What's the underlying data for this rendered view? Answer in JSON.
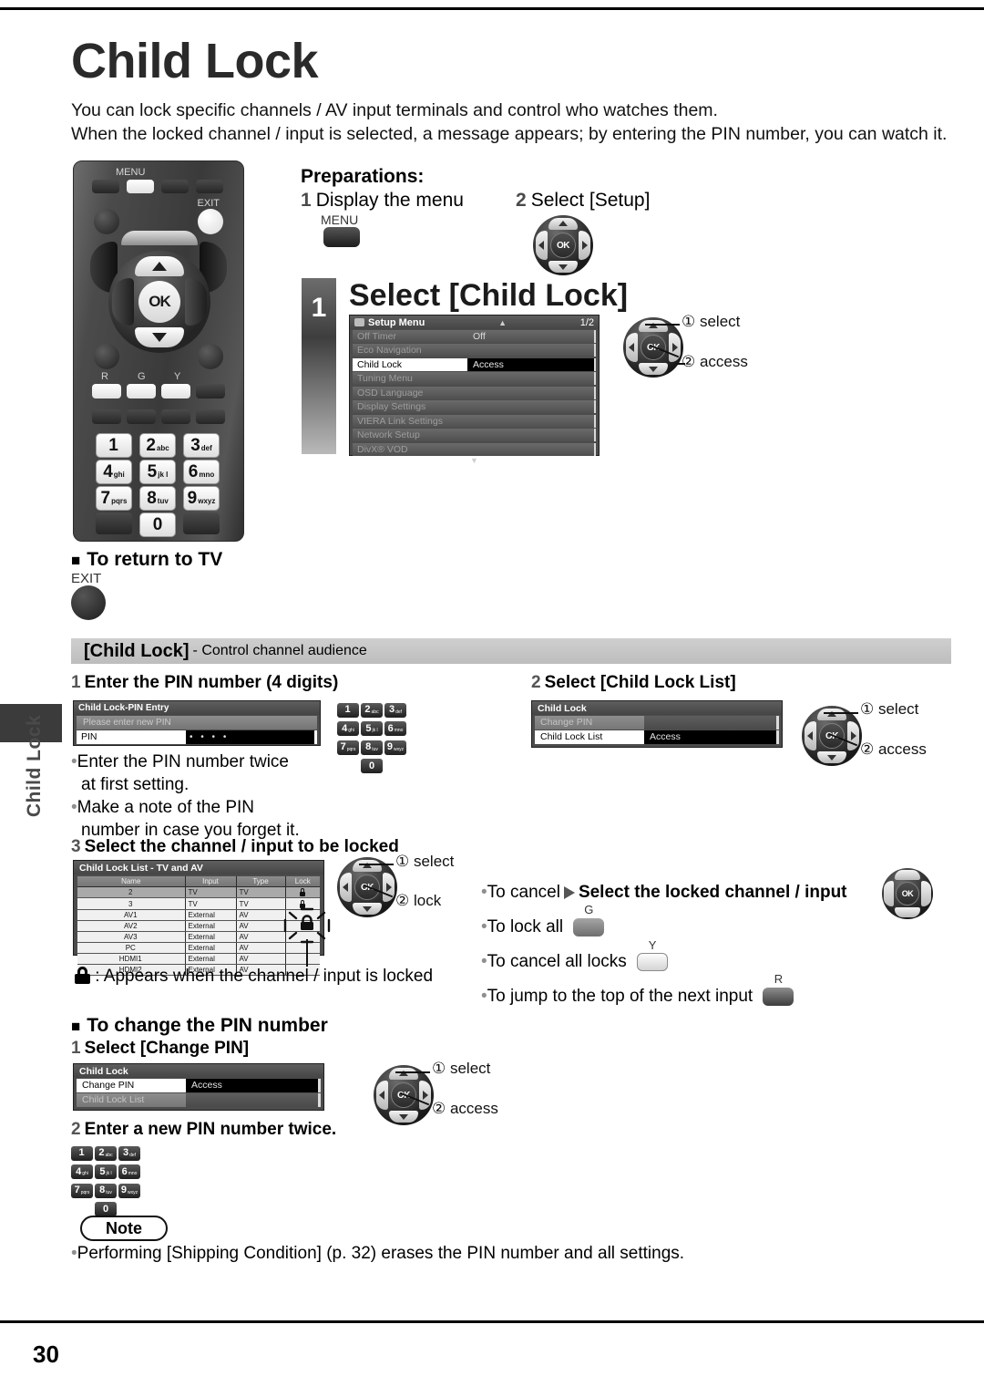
{
  "page": {
    "title": "Child Lock",
    "number": "30",
    "side_tab_label": "Child Lock",
    "intro_lines": [
      "You can lock specific channels / AV input terminals and control who watches them.",
      "When the locked channel / input is selected, a message appears; by entering the PIN number, you can watch it."
    ]
  },
  "remote": {
    "menu_label": "MENU",
    "exit_label": "EXIT",
    "ok_label": "OK",
    "color_labels": [
      "R",
      "G",
      "Y"
    ],
    "keys": [
      {
        "digit": "1",
        "letters": ""
      },
      {
        "digit": "2",
        "letters": "abc"
      },
      {
        "digit": "3",
        "letters": "def"
      },
      {
        "digit": "4",
        "letters": "ghi"
      },
      {
        "digit": "5",
        "letters": "jk l"
      },
      {
        "digit": "6",
        "letters": "mno"
      },
      {
        "digit": "7",
        "letters": "pqrs"
      },
      {
        "digit": "8",
        "letters": "tuv"
      },
      {
        "digit": "9",
        "letters": "wxyz"
      },
      {
        "digit": "0",
        "letters": ""
      }
    ]
  },
  "preparations": {
    "heading": "Preparations:",
    "step1_num": "1",
    "step1_text": "Display the menu",
    "step1_button_caption": "MENU",
    "step2_num": "2",
    "step2_text": "Select [Setup]"
  },
  "step1": {
    "num": "1",
    "title": "Select [Child Lock]",
    "callout_select": "① select",
    "callout_access": "② access"
  },
  "setup_menu": {
    "title": "Setup Menu",
    "page_indicator": "1/2",
    "rows": [
      {
        "label": "Off Timer",
        "value": "Off",
        "state": "dim"
      },
      {
        "label": "Eco Navigation",
        "value": "",
        "state": "dim"
      },
      {
        "label": "Child Lock",
        "value": "Access",
        "state": "selected"
      },
      {
        "label": "Tuning Menu",
        "value": "",
        "state": "dim"
      },
      {
        "label": "OSD Language",
        "value": "",
        "state": "dim"
      },
      {
        "label": "Display Settings",
        "value": "",
        "state": "dim"
      },
      {
        "label": "VIERA Link Settings",
        "value": "",
        "state": "dim"
      },
      {
        "label": "Network Setup",
        "value": "",
        "state": "dim"
      },
      {
        "label": "DivX® VOD",
        "value": "",
        "state": "dim"
      }
    ]
  },
  "return_to_tv": {
    "heading": "To return to TV",
    "button_caption": "EXIT"
  },
  "section_bar": {
    "bold": "[Child Lock]",
    "small": "- Control channel audience"
  },
  "pin_step": {
    "num": "1",
    "heading": "Enter the PIN number (4 digits)",
    "osd_title": "Child Lock-PIN Entry",
    "osd_message": "Please enter new PIN",
    "osd_field_label": "PIN",
    "osd_field_value": "• • • •",
    "bullets": [
      "Enter the PIN number twice",
      "at first setting.",
      "Make a note of the PIN",
      "number in case you forget it."
    ]
  },
  "child_lock_list_step": {
    "num": "2",
    "heading": "Select [Child Lock List]",
    "osd_title": "Child Lock",
    "rows": [
      {
        "label": "Change PIN",
        "value": "",
        "state": "dim"
      },
      {
        "label": "Child Lock List",
        "value": "Access",
        "state": "selected"
      }
    ],
    "callout_select": "① select",
    "callout_access": "② access"
  },
  "select_channel_step": {
    "num": "3",
    "heading": "Select the channel / input to be locked",
    "callout_select": "① select",
    "callout_lock": "② lock",
    "lock_note": ": Appears when the channel / input is locked"
  },
  "lock_list_osd": {
    "title": "Child Lock List - TV and AV",
    "columns": [
      "Name",
      "Input",
      "Type",
      "Lock"
    ],
    "rows": [
      {
        "name": "2",
        "input": "TV",
        "type": "TV",
        "locked": true,
        "highlight": true
      },
      {
        "name": "3",
        "input": "TV",
        "type": "TV",
        "locked": true,
        "highlight": false
      },
      {
        "name": "AV1",
        "input": "External",
        "type": "AV",
        "locked": false,
        "highlight": false
      },
      {
        "name": "AV2",
        "input": "External",
        "type": "AV",
        "locked": false,
        "highlight": false
      },
      {
        "name": "AV3",
        "input": "External",
        "type": "AV",
        "locked": false,
        "highlight": false
      },
      {
        "name": "PC",
        "input": "External",
        "type": "AV",
        "locked": false,
        "highlight": false
      },
      {
        "name": "HDMI1",
        "input": "External",
        "type": "AV",
        "locked": false,
        "highlight": false
      },
      {
        "name": "HDMI2",
        "input": "External",
        "type": "AV",
        "locked": false,
        "highlight": false
      }
    ]
  },
  "actions": [
    {
      "text": "To cancel",
      "arrow": true,
      "bold_text": "Select the locked channel / input",
      "control": "dpad"
    },
    {
      "text": "To lock all",
      "arrow": false,
      "bold_text": "",
      "control": "green-button",
      "control_caption": "G"
    },
    {
      "text": "To cancel all locks",
      "arrow": false,
      "bold_text": "",
      "control": "yellow-button",
      "control_caption": "Y"
    },
    {
      "text": "To jump to the top of the next input",
      "arrow": false,
      "bold_text": "",
      "control": "red-button",
      "control_caption": "R"
    }
  ],
  "change_pin": {
    "heading": "To change the PIN number",
    "step1_num": "1",
    "step1_heading": "Select [Change PIN]",
    "osd_title": "Child Lock",
    "rows": [
      {
        "label": "Change PIN",
        "value": "Access",
        "state": "selected"
      },
      {
        "label": "Child Lock List",
        "value": "",
        "state": "dim"
      }
    ],
    "callout_select": "① select",
    "callout_access": "② access",
    "step2_num": "2",
    "step2_heading": "Enter a new PIN number twice."
  },
  "note": {
    "label": "Note",
    "text": "Performing [Shipping Condition] (p. 32) erases the PIN number and all settings."
  }
}
